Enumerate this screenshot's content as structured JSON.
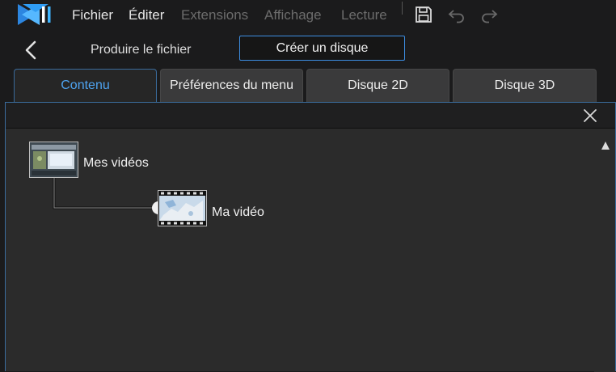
{
  "menu": {
    "file": "Fichier",
    "edit": "Éditer",
    "extensions": "Extensions",
    "view": "Affichage",
    "playback": "Lecture"
  },
  "produce": {
    "produce_file": "Produire le fichier",
    "create_disc": "Créer un disque"
  },
  "tabs": [
    {
      "label": "Contenu",
      "active": true
    },
    {
      "label": "Préférences du menu",
      "active": false
    },
    {
      "label": "Disque 2D",
      "active": false
    },
    {
      "label": "Disque 3D",
      "active": false
    }
  ],
  "tree": {
    "root": {
      "label": "Mes vidéos",
      "icon": "folder-thumbnail-icon"
    },
    "child": {
      "label": "Ma vidéo",
      "icon": "video-thumbnail-icon"
    }
  },
  "icons": {
    "logo": "app-logo-icon",
    "save": "save-icon",
    "undo": "undo-icon",
    "redo": "redo-icon",
    "back": "back-arrow-icon",
    "close": "close-icon",
    "scroll": "scroll-up-icon"
  },
  "colors": {
    "accent": "#3d8ee3",
    "active_tab_text": "#4ea3f0",
    "background": "#1b1b1c",
    "panel": "#2b2b2b"
  }
}
